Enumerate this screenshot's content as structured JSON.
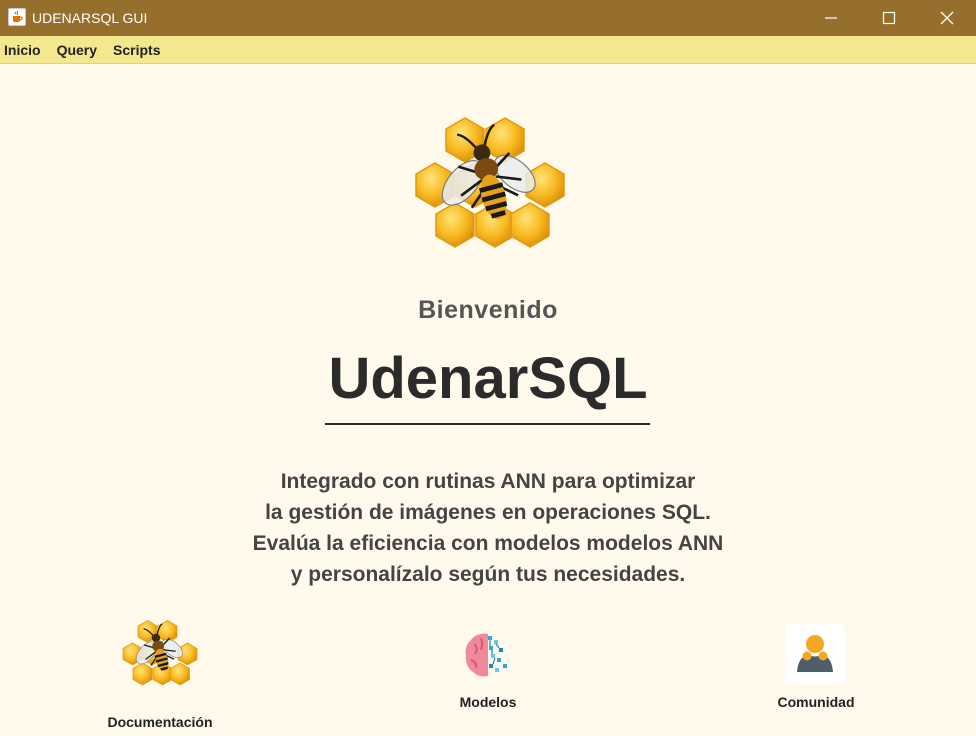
{
  "window": {
    "title": "UDENARSQL GUI",
    "app_icon": "java-cup-icon",
    "controls": [
      "minimize-icon",
      "maximize-icon",
      "close-icon"
    ]
  },
  "menu": {
    "items": [
      "Inicio",
      "Query",
      "Scripts"
    ]
  },
  "main": {
    "logo_icon": "bee-honeycomb-logo",
    "welcome": "Bienvenido",
    "app_name": "UdenarSQL",
    "description": [
      "Integrado con rutinas ANN para optimizar",
      "la gestión de imágenes en operaciones SQL.",
      "Evalúa la eficiencia con modelos modelos ANN",
      "y personalízalo según tus necesidades."
    ]
  },
  "features": [
    {
      "label": "Documentación",
      "icon": "bee-honeycomb-icon"
    },
    {
      "label": "Modelos",
      "icon": "brain-circuit-icon"
    },
    {
      "label": "Comunidad",
      "icon": "user-community-icon"
    }
  ],
  "colors": {
    "titlebar": "#966f2d",
    "menubar": "#f3e88e",
    "background": "#fffaeb",
    "honey": "#f5b82a",
    "text_dark": "#2b2b2b"
  }
}
